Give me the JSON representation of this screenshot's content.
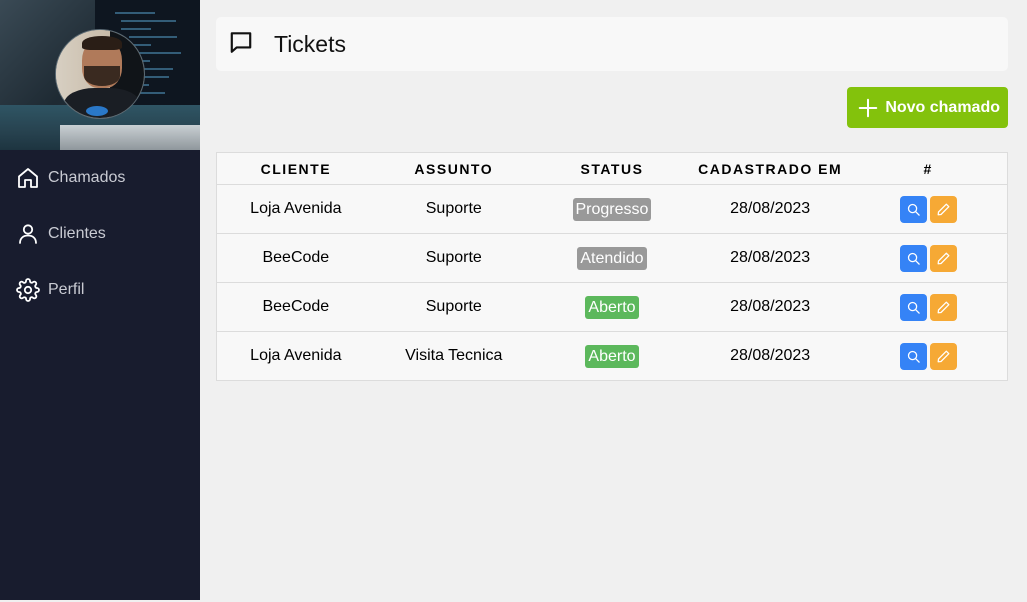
{
  "sidebar": {
    "items": [
      {
        "label": "Chamados",
        "icon": "home-icon"
      },
      {
        "label": "Clientes",
        "icon": "user-icon"
      },
      {
        "label": "Perfil",
        "icon": "gear-icon"
      }
    ]
  },
  "header": {
    "title": "Tickets",
    "icon": "message-icon"
  },
  "new_button": {
    "label": "Novo chamado",
    "icon": "plus-icon"
  },
  "table": {
    "columns": [
      "CLIENTE",
      "ASSUNTO",
      "STATUS",
      "CADASTRADO EM",
      "#"
    ],
    "rows": [
      {
        "cliente": "Loja Avenida",
        "assunto": "Suporte",
        "status": "Progresso",
        "cadastrado": "28/08/2023"
      },
      {
        "cliente": "BeeCode",
        "assunto": "Suporte",
        "status": "Atendido",
        "cadastrado": "28/08/2023"
      },
      {
        "cliente": "BeeCode",
        "assunto": "Suporte",
        "status": "Aberto",
        "cadastrado": "28/08/2023"
      },
      {
        "cliente": "Loja Avenida",
        "assunto": "Visita Tecnica",
        "status": "Aberto",
        "cadastrado": "28/08/2023"
      }
    ]
  },
  "colors": {
    "sidebar_bg": "#181c2e",
    "new_button": "#83c20c",
    "status_progresso": "#999999",
    "status_atendido": "#999999",
    "status_aberto": "#5cb85c",
    "search_button": "#3583f6",
    "edit_button": "#f6a935"
  }
}
